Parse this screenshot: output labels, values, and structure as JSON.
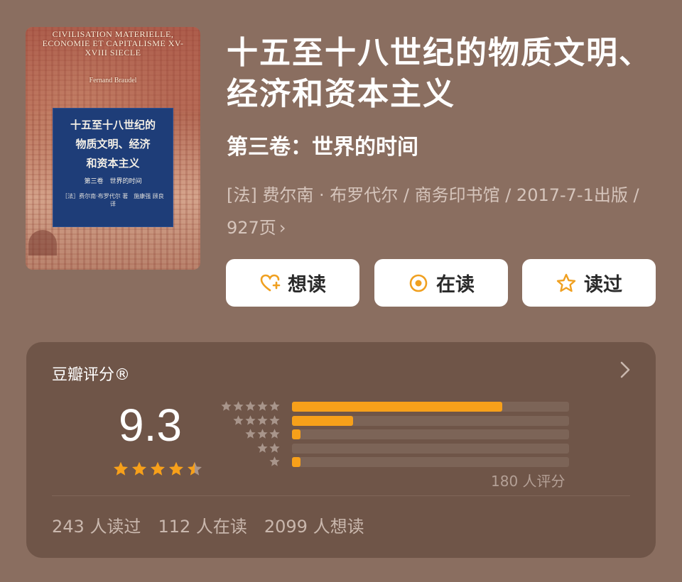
{
  "cover": {
    "en_title": "CIVILISATION MATERIELLE, ECONOMIE ET CAPITALISME XV-XVIII SIECLE",
    "en_author": "Fernand Braudel",
    "zh_title_lines": [
      "十五至十八世纪的",
      "物质文明、经济",
      "和资本主义"
    ],
    "zh_volume": "第三卷　世界的时间",
    "zh_authors": "［法］费尔南·布罗代尔 著　施康强 顾良 译"
  },
  "book": {
    "title": "十五至十八世纪的物质文明、经济和资本主义",
    "subtitle": "第三卷：世界的时间",
    "meta": "[法] 费尔南 · 布罗代尔 / 商务印书馆 / 2017-7-1出版 / 927页",
    "meta_chevron": "›"
  },
  "actions": {
    "want_label": "想读",
    "reading_label": "在读",
    "read_label": "读过",
    "icons": {
      "want": "heart-plus-icon",
      "reading": "circle-dot-icon",
      "read": "star-outline-icon"
    }
  },
  "rating": {
    "title": "豆瓣评分®",
    "score": "9.3",
    "stars": 4.5,
    "distribution": [
      {
        "stars": 5,
        "fraction": 0.76
      },
      {
        "stars": 4,
        "fraction": 0.22
      },
      {
        "stars": 3,
        "fraction": 0.03
      },
      {
        "stars": 2,
        "fraction": 0.0
      },
      {
        "stars": 1,
        "fraction": 0.03
      }
    ],
    "count_text": "180 人评分",
    "stats": [
      "243 人读过",
      "112 人在读",
      "2099 人想读"
    ]
  },
  "colors": {
    "background": "#8a6e60",
    "card": "#6f5548",
    "accent": "#f7a01a",
    "star_gray": "#a8958b"
  }
}
